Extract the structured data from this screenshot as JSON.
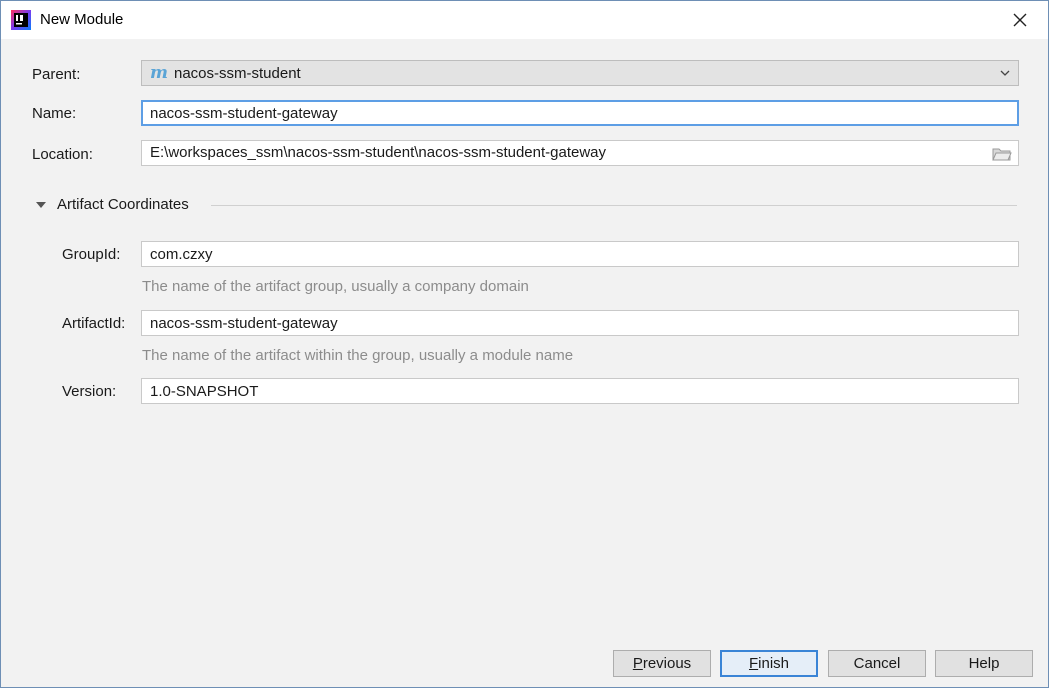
{
  "window": {
    "title": "New Module"
  },
  "form": {
    "parent": {
      "label": "Parent:",
      "value": "nacos-ssm-student"
    },
    "name": {
      "label": "Name:",
      "value": "nacos-ssm-student-gateway"
    },
    "location": {
      "label": "Location:",
      "value": "E:\\workspaces_ssm\\nacos-ssm-student\\nacos-ssm-student-gateway"
    }
  },
  "artifact": {
    "section_title": "Artifact Coordinates",
    "group_id": {
      "label": "GroupId:",
      "value": "com.czxy",
      "hint": "The name of the artifact group, usually a company domain"
    },
    "artifact_id": {
      "label": "ArtifactId:",
      "value": "nacos-ssm-student-gateway",
      "hint": "The name of the artifact within the group, usually a module name"
    },
    "version": {
      "label": "Version:",
      "value": "1.0-SNAPSHOT"
    }
  },
  "buttons": {
    "previous": {
      "mnemonic": "P",
      "rest": "revious"
    },
    "finish": {
      "mnemonic": "F",
      "rest": "inish"
    },
    "cancel": "Cancel",
    "help": "Help"
  },
  "icons": {
    "app": "intellij-idea-icon",
    "parent": "maven-m-icon",
    "parent_glyph": "m",
    "folder": "folder-icon",
    "close": "close-icon"
  },
  "colors": {
    "accent": "#5d9ee5",
    "default_button_border": "#3a84d6",
    "hint_text": "#8c8c8c",
    "maven_blue": "#5aa4d6"
  }
}
